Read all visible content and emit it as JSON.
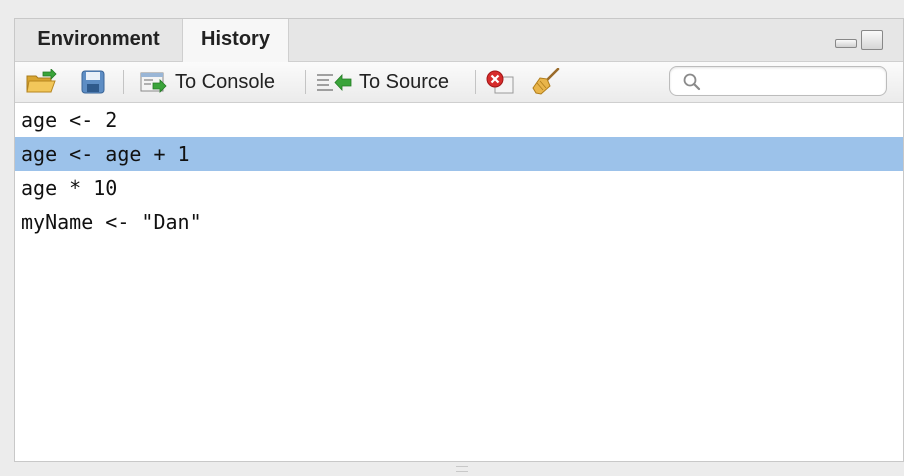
{
  "tabs": {
    "environment": "Environment",
    "history": "History"
  },
  "toolbar": {
    "to_console": "To Console",
    "to_source": "To Source",
    "search_placeholder": ""
  },
  "history": {
    "entries": [
      "age <- 2",
      "age <- age + 1",
      "age * 10",
      "myName <- \"Dan\""
    ],
    "selected_index": 1
  },
  "colors": {
    "selection": "#9cc2ea",
    "tab_active": "#f7f7f7",
    "tab_bar": "#e6e6e6"
  }
}
